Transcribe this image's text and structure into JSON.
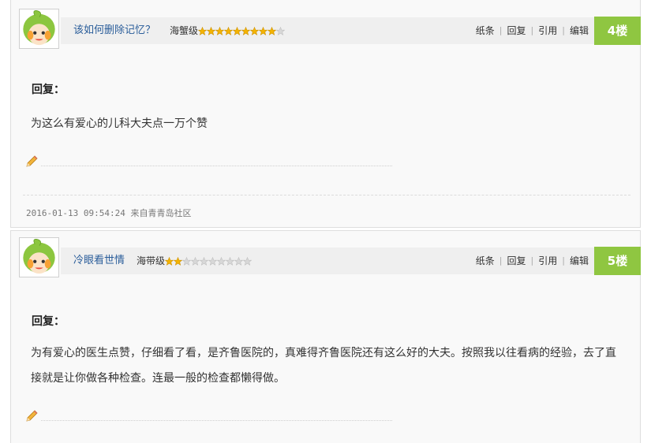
{
  "colors": {
    "floor_bg": "#8fc641",
    "username": "#2a5d9a",
    "header_bg": "#efefef",
    "star_on": "#f5b400",
    "star_off": "#d8d8d8"
  },
  "posts": [
    {
      "username": "该如何删除记忆？",
      "level": "海蟹级",
      "stars_filled": 9,
      "stars_total": 10,
      "actions": [
        "纸条",
        "回复",
        "引用",
        "编辑"
      ],
      "floor": "4楼",
      "reply_label": "回复：",
      "content": "为这么有爱心的儿科大夫点一万个赞",
      "timestamp": "2016-01-13 09:54:24",
      "source": "来自青青岛社区",
      "avatar_icon": "mascot-avatar-icon",
      "signature_icon": "pencil-icon"
    },
    {
      "username": "冷眼看世情",
      "level": "海带级",
      "stars_filled": 2,
      "stars_total": 10,
      "actions": [
        "纸条",
        "回复",
        "引用",
        "编辑"
      ],
      "floor": "5楼",
      "reply_label": "回复：",
      "content": "为有爱心的医生点赞，仔细看了看，是齐鲁医院的，真难得齐鲁医院还有这么好的大夫。按照我以往看病的经验，去了直接就是让你做各种检查。连最一般的检查都懒得做。",
      "avatar_icon": "mascot-avatar-icon",
      "signature_icon": "pencil-icon"
    }
  ]
}
